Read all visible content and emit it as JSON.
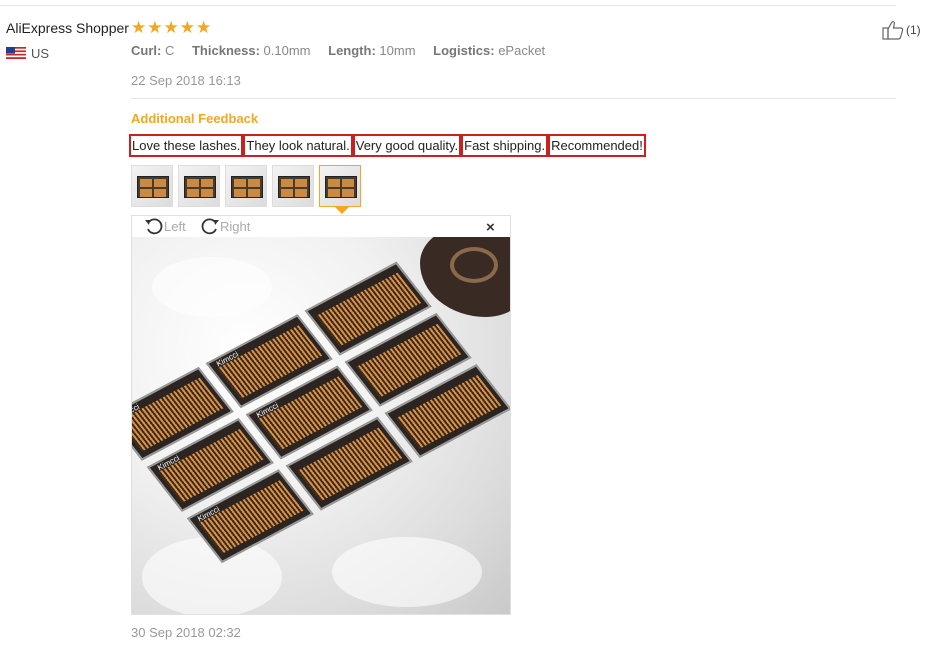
{
  "review": {
    "user_name": "AliExpress Shopper",
    "country": "US",
    "rating": 5,
    "like_count": "(1)",
    "attributes": [
      {
        "key": "Curl:",
        "value": "C"
      },
      {
        "key": "Thickness:",
        "value": "0.10mm"
      },
      {
        "key": "Length:",
        "value": "10mm"
      },
      {
        "key": "Logistics:",
        "value": "ePacket"
      }
    ],
    "date": "22 Sep 2018 16:13"
  },
  "additional_feedback": {
    "title": "Additional Feedback",
    "phrases": [
      "Love these lashes.",
      "They look natural.",
      "Very good quality.",
      "Fast shipping.",
      "Recommended!"
    ],
    "thumbnail_count": 5,
    "active_thumbnail": 5,
    "viewer": {
      "rotate_left_label": "Left",
      "rotate_right_label": "Right",
      "close_label": "×",
      "brand_text": "Kimcci"
    },
    "date": "30 Sep 2018 02:32"
  },
  "colors": {
    "accent": "#f5a623",
    "highlight_border": "#cc1f1f"
  }
}
